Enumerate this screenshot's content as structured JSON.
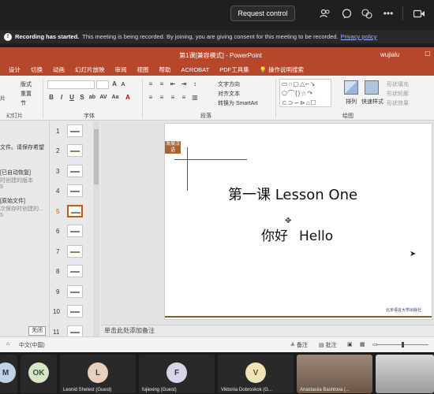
{
  "teams": {
    "request_control": "Request control",
    "top_icons": [
      "people-icon",
      "chat-icon",
      "reactions-icon",
      "more-icon",
      "camera-icon"
    ],
    "banner": {
      "bold": "Recording has started.",
      "text": "This meeting is being recorded. By joining, you are giving consent for this meeting to be recorded.",
      "link": "Privacy policy"
    }
  },
  "ppt": {
    "doc_title": "第1课[兼容模式] - PowerPoint",
    "user": "wujialu",
    "tabs": [
      "设计",
      "切换",
      "动画",
      "幻灯片放映",
      "审阅",
      "视图",
      "帮助",
      "ACROBAT",
      "PDF工具集",
      "操作说明搜索"
    ],
    "ribbon": {
      "layout": "版式",
      "reset": "重置",
      "section": "节",
      "slide_label_frag": "灯片",
      "new_slide_frag": "片",
      "group_slides": "幻灯片",
      "group_font": "字体",
      "group_paragraph": "段落",
      "group_drawing": "绘图",
      "text_direction": "文字方向",
      "align_text": "对齐文本",
      "smartart": "转换为 SmartArt",
      "arrange": "排列",
      "quick_styles": "快速样式",
      "shape_fill": "形状填充",
      "shape_outline": "形状轮廓",
      "shape_effects": "形状效果"
    },
    "left_panel": {
      "line1": "文件。请保存希望",
      "line2": "[已自动恢复]",
      "line3": "时创建的版本",
      "line4": "9",
      "line5": "[原始文件]",
      "line6": "次保存时创建的...",
      "line7": "5",
      "close": "关闭"
    },
    "thumbnails": [
      "1",
      "2",
      "3",
      "4",
      "5",
      "6",
      "7",
      "8",
      "9",
      "10",
      "11"
    ],
    "active_slide": "5",
    "slide": {
      "badge": "发展汉语",
      "title": "第一课 Lesson One",
      "sub_cn": "你好",
      "sub_en": "Hello",
      "logo": "北京语言大学出版社"
    },
    "notes_placeholder": "单击此处添加备注",
    "status": {
      "lang": "中文(中国)",
      "notes": "备注",
      "comments": "批注"
    }
  },
  "participants": [
    {
      "initials": "M",
      "name": ""
    },
    {
      "initials": "OK",
      "name": ""
    },
    {
      "initials": "L",
      "name": "Leonid Shelest (Guest)"
    },
    {
      "initials": "F",
      "name": "fujiexing (Guest)"
    },
    {
      "initials": "V",
      "name": "Viktoriia Dobroskok (G..."
    },
    {
      "initials": "",
      "name": "Anastasiia Bashtova (..."
    }
  ],
  "colors": {
    "ppt_accent": "#b7472a",
    "slide_brown": "#8b5a2b",
    "active_thumb": "#c55a11"
  }
}
